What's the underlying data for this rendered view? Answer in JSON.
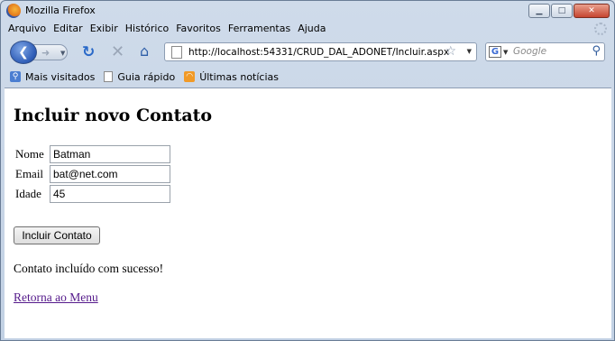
{
  "window": {
    "title": "Mozilla Firefox",
    "controls": {
      "minimize": "▁",
      "maximize": "□",
      "close": "✕"
    }
  },
  "menubar": {
    "items": [
      "Arquivo",
      "Editar",
      "Exibir",
      "Histórico",
      "Favoritos",
      "Ferramentas",
      "Ajuda"
    ]
  },
  "toolbar": {
    "url": "http://localhost:54331/CRUD_DAL_ADONET/Incluir.aspx",
    "search_placeholder": "Google",
    "icons": {
      "back": "back-arrow-icon",
      "forward": "forward-arrow-icon",
      "reload": "reload-icon",
      "stop": "stop-icon",
      "home": "home-icon",
      "bookmark_star": "star-icon",
      "search": "search-icon"
    }
  },
  "bookmarks": {
    "items": [
      {
        "label": "Mais visitados",
        "icon": "most-visited-icon"
      },
      {
        "label": "Guia rápido",
        "icon": "page-icon"
      },
      {
        "label": "Últimas notícias",
        "icon": "rss-icon"
      }
    ]
  },
  "page": {
    "title": "Incluir novo Contato",
    "form": {
      "fields": [
        {
          "label": "Nome",
          "value": "Batman"
        },
        {
          "label": "Email",
          "value": "bat@net.com"
        },
        {
          "label": "Idade",
          "value": "45"
        }
      ],
      "submit_label": "Incluir Contato"
    },
    "status_message": "Contato incluído com sucesso!",
    "back_link": "Retorna ao Menu"
  },
  "colors": {
    "chrome": "#cfdbea",
    "link_visited": "#551a8b",
    "close_button": "#c64530"
  }
}
